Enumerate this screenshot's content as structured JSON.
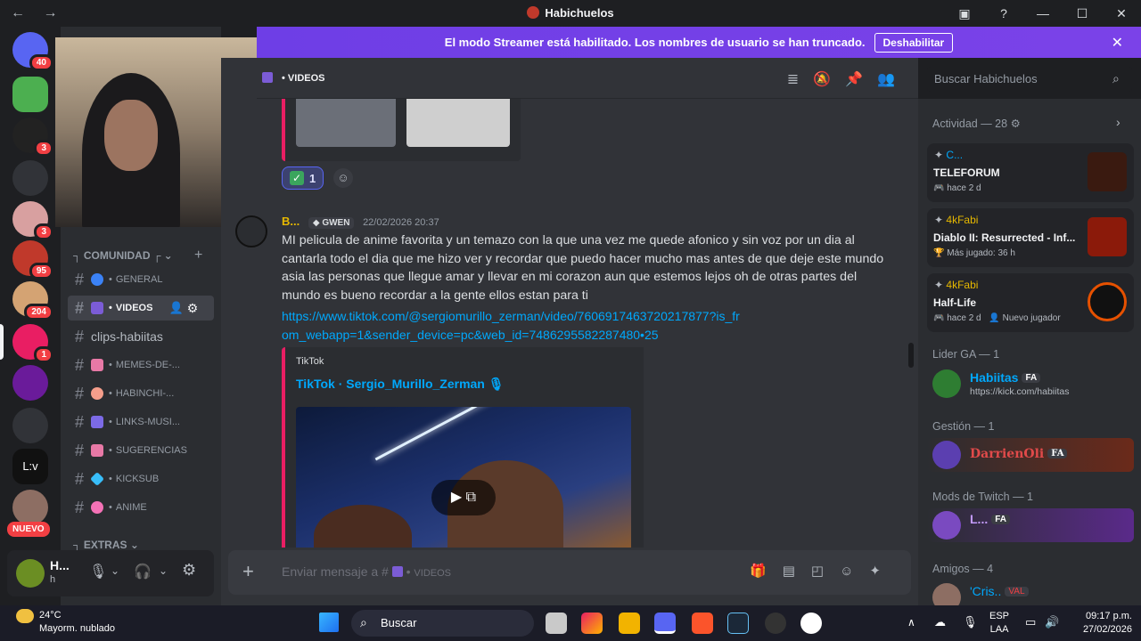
{
  "window": {
    "title": "Habichuelos",
    "nav": "← →"
  },
  "banner": {
    "text": "El modo Streamer está habilitado. Los nombres de usuario se han truncado.",
    "button": "Deshabilitar"
  },
  "servers": {
    "badges": [
      "40",
      "3",
      "3",
      "95",
      "204",
      "1"
    ],
    "lv_label": "L:v",
    "new_label": "NUEVO"
  },
  "channels": {
    "category_community": "COMUNIDAD",
    "category_extras": "EXTRAS",
    "items": [
      {
        "name": "GENERAL",
        "color": "#3b82f6"
      },
      {
        "name": "VIDEOS",
        "color": "#7b5cd6"
      },
      {
        "name": "clips-habiitas",
        "color": ""
      },
      {
        "name": "MEMES-DE-...",
        "color": "#e879a6"
      },
      {
        "name": "HABINCHI-...",
        "color": "#f59e8b"
      },
      {
        "name": "LINKS-MUSI...",
        "color": "#7c6ae6"
      },
      {
        "name": "SUGERENCIAS",
        "color": "#e879a6"
      },
      {
        "name": "KICKSUB",
        "color": "#38bdf8"
      },
      {
        "name": "ANIME",
        "color": "#f472b6"
      }
    ]
  },
  "user": {
    "name": "H...",
    "status": "h"
  },
  "header": {
    "channel": "VIDEOS",
    "search_placeholder": "Buscar Habichuelos"
  },
  "message": {
    "reaction_count": "1",
    "author": "B...",
    "role_tag": "GWEN",
    "timestamp": "22/02/2026 20:37",
    "text": "MI pelicula de anime favorita  y un temazo  con la que una vez me quede afonico y sin voz por un dia al cantarla todo el dia  que me hizo ver y recordar que puedo hacer mucho mas antes de que deje este mundo asia las personas que llegue amar y llevar en mi corazon aun que estemos lejos oh de otras partes del mundo es bueno recordar a la gente ellos estan para ti",
    "link": "https://www.tiktok.com/@sergiomurillo_zerman/video/7606917463720217877?is_from_webapp=1&sender_device=pc&web_id=7486295582287480•25",
    "embed_provider": "TikTok",
    "embed_title": "TikTok · Sergio_Murillo_Zerman 🎙"
  },
  "composer": {
    "placeholder": "Enviar mensaje a #",
    "channel": "VIDEOS"
  },
  "members": {
    "activity_header": "Actividad — 28",
    "activities": [
      {
        "user": "C...",
        "title": "TELEFORUM",
        "meta": "hace 2 d",
        "user_color": "#00a8fc"
      },
      {
        "user": "4kFabi",
        "title": "Diablo II: Resurrected - Inf...",
        "meta": "Más jugado: 36 h",
        "user_color": "#e6b800"
      },
      {
        "user": "4kFabi",
        "title": "Half-Life",
        "meta": "hace 2 d",
        "extra": "Nuevo jugador",
        "user_color": "#e6b800"
      }
    ],
    "lider_header": "Lider GA — 1",
    "lider": {
      "name": "Habiitas",
      "tag": "FA",
      "sub": "https://kick.com/habiitas"
    },
    "gestion_header": "Gestión — 1",
    "gestion": {
      "name": "DarrienOli",
      "tag": "FA"
    },
    "mods_header": "Mods de Twitch — 1",
    "mod": {
      "name": "L...",
      "tag": "FA"
    },
    "amigos_header": "Amigos — 4",
    "amigo": {
      "name": "'Cris..",
      "tag": "VAL"
    }
  },
  "taskbar": {
    "weather_temp": "24°C",
    "weather_desc": "Mayorm. nublado",
    "search": "Buscar",
    "lang": "ESP",
    "lang2": "LAA",
    "time": "09:17 p.m.",
    "date": "27/02/2026"
  }
}
